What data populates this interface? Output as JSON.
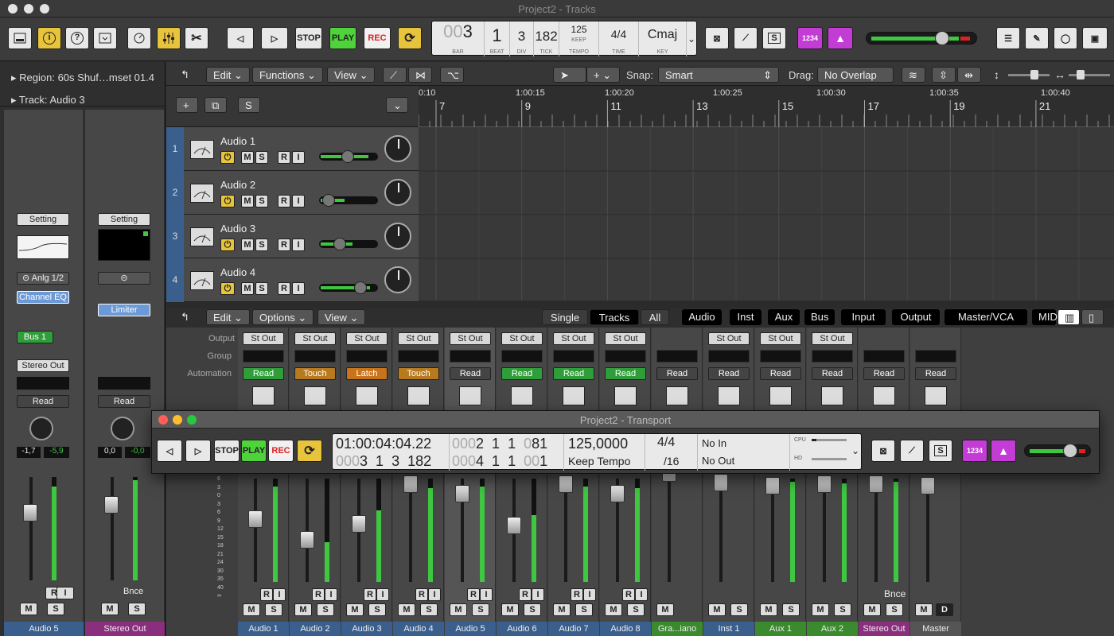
{
  "window": {
    "title": "Project2 - Tracks"
  },
  "control_bar": {
    "stop": "STOP",
    "play": "PLAY",
    "rec": "REC",
    "key_num": "1234"
  },
  "lcd": {
    "bar": "3",
    "bar_prefix": "00",
    "beat": "1",
    "div": "3",
    "tick": "182",
    "tempo": "125",
    "tempo_mode": "KEEP",
    "tempo_label": "TEMPO",
    "time": "4/4",
    "key": "Cmaj",
    "bar_label": "BAR",
    "beat_label": "BEAT",
    "div_label": "DIV",
    "tick_label": "TICK",
    "time_label": "TIME",
    "key_label": "KEY"
  },
  "inspector": {
    "region_label": "Region:",
    "region_name": "60s Shuf…mset 01.4",
    "track_label": "Track:",
    "track_name": "Audio 3",
    "strip1": {
      "setting": "Setting",
      "input": "Anlg 1/2",
      "plugin": "Channel EQ",
      "send": "Bus 1",
      "output": "Stereo Out",
      "automation": "Read",
      "pan_l": "-1,7",
      "pan_r": "-5,9",
      "name": "Audio 5"
    },
    "strip2": {
      "setting": "Setting",
      "plugin": "Limiter",
      "automation": "Read",
      "pan_l": "0,0",
      "pan_r": "-0,0",
      "bounce": "Bnce",
      "name": "Stereo Out"
    }
  },
  "tracks_toolbar": {
    "edit": "Edit",
    "functions": "Functions",
    "view": "View",
    "snap_label": "Snap:",
    "snap_value": "Smart",
    "drag_label": "Drag:",
    "drag_value": "No Overlap"
  },
  "ruler": {
    "times": [
      "0:10",
      "1:00:15",
      "1:00:20",
      "1:00:25",
      "1:00:30",
      "1:00:35",
      "1:00:40"
    ],
    "bars": [
      "7",
      "9",
      "11",
      "13",
      "15",
      "17",
      "19",
      "21"
    ]
  },
  "tracks": [
    {
      "num": "1",
      "name": "Audio 1"
    },
    {
      "num": "2",
      "name": "Audio 2"
    },
    {
      "num": "3",
      "name": "Audio 3"
    },
    {
      "num": "4",
      "name": "Audio 4"
    }
  ],
  "mixer_toolbar": {
    "edit": "Edit",
    "options": "Options",
    "view": "View",
    "single": "Single",
    "tracks": "Tracks",
    "all": "All",
    "filters": [
      "Audio",
      "Inst",
      "Aux",
      "Bus",
      "Input",
      "Output",
      "Master/VCA",
      "MIDI"
    ]
  },
  "mixer_labels": {
    "output": "Output",
    "group": "Group",
    "automation": "Automation"
  },
  "channels": [
    {
      "out": "St Out",
      "auto": "Read",
      "auto_color": "#2f9e3a",
      "name": "Audio 1",
      "color": "#3a5f8c"
    },
    {
      "out": "St Out",
      "auto": "Touch",
      "auto_color": "#b87a1e",
      "name": "Audio 2",
      "color": "#3a5f8c"
    },
    {
      "out": "St Out",
      "auto": "Latch",
      "auto_color": "#c9731b",
      "name": "Audio 3",
      "color": "#3a5f8c"
    },
    {
      "out": "St Out",
      "auto": "Touch",
      "auto_color": "#b87a1e",
      "name": "Audio 4",
      "color": "#3a5f8c"
    },
    {
      "out": "St Out",
      "auto": "Read",
      "auto_color": "#444",
      "name": "Audio 5",
      "color": "#3a5f8c"
    },
    {
      "out": "St Out",
      "auto": "Read",
      "auto_color": "#2f9e3a",
      "name": "Audio 6",
      "color": "#3a5f8c"
    },
    {
      "out": "St Out",
      "auto": "Read",
      "auto_color": "#2f9e3a",
      "name": "Audio 7",
      "color": "#3a5f8c"
    },
    {
      "out": "St Out",
      "auto": "Read",
      "auto_color": "#2f9e3a",
      "name": "Audio 8",
      "color": "#3a5f8c"
    },
    {
      "out": "",
      "auto": "Read",
      "auto_color": "#444",
      "name": "Gra...iano",
      "color": "#3c8a2e"
    },
    {
      "out": "St Out",
      "auto": "Read",
      "auto_color": "#444",
      "name": "Inst 1",
      "color": "#3a5f8c"
    },
    {
      "out": "St Out",
      "auto": "Read",
      "auto_color": "#444",
      "name": "Aux 1",
      "color": "#3c8a2e"
    },
    {
      "out": "St Out",
      "auto": "Read",
      "auto_color": "#444",
      "name": "Aux 2",
      "color": "#3c8a2e"
    },
    {
      "out": "",
      "auto": "Read",
      "auto_color": "#444",
      "name": "Stereo Out",
      "color": "#8a2e7e"
    },
    {
      "out": "",
      "auto": "Read",
      "auto_color": "#444",
      "name": "Master",
      "color": "#555"
    }
  ],
  "transport": {
    "title": "Project2 - Transport",
    "smpte": "01:00:04:04.22",
    "bbt": "3  1  3  182",
    "bbt_prefix": "000",
    "loop_start_prefix": "000",
    "loop_start": "2  1  1",
    "loop_start_tick": "81",
    "loop_start_tick_prefix": "0",
    "loop_end_prefix": "000",
    "loop_end": "4  1  1",
    "loop_end_tick": "1",
    "loop_end_tick_prefix": "00",
    "tempo": "125,0000",
    "tempo_mode": "Keep Tempo",
    "sig": "4/4",
    "div": "/16",
    "in": "No In",
    "out": "No Out",
    "cpu": "CPU",
    "hd": "HD",
    "stop": "STOP",
    "play": "PLAY",
    "rec": "REC",
    "key_num": "1234"
  },
  "common": {
    "m": "M",
    "s": "S",
    "r": "R",
    "i": "I",
    "d": "D",
    "bnce": "Bnce"
  }
}
